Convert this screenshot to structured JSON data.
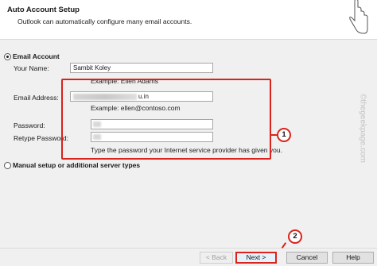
{
  "header": {
    "title": "Auto Account Setup",
    "subtitle": "Outlook can automatically configure many email accounts."
  },
  "email_account": {
    "label": "Email Account",
    "selected": true,
    "your_name_label": "Your Name:",
    "your_name_value": "Sambit Koley",
    "your_name_hint": "Example: Ellen Adams",
    "email_label": "Email Address:",
    "email_value_visible": "u.in",
    "email_hint": "Example: ellen@contoso.com",
    "password_label": "Password:",
    "retype_label": "Retype Password:",
    "password_hint": "Type the password your Internet service provider has given you."
  },
  "manual_setup": {
    "label": "Manual setup or additional server types",
    "selected": false
  },
  "buttons": {
    "back": "< Back",
    "next": "Next >",
    "cancel": "Cancel",
    "help": "Help"
  },
  "annotations": {
    "badge_1": "1",
    "badge_2": "2",
    "highlight_color": "#d9231c"
  },
  "watermark": "©thegeekpage.com",
  "icons": {
    "cursor": "hand-cursor-icon"
  }
}
